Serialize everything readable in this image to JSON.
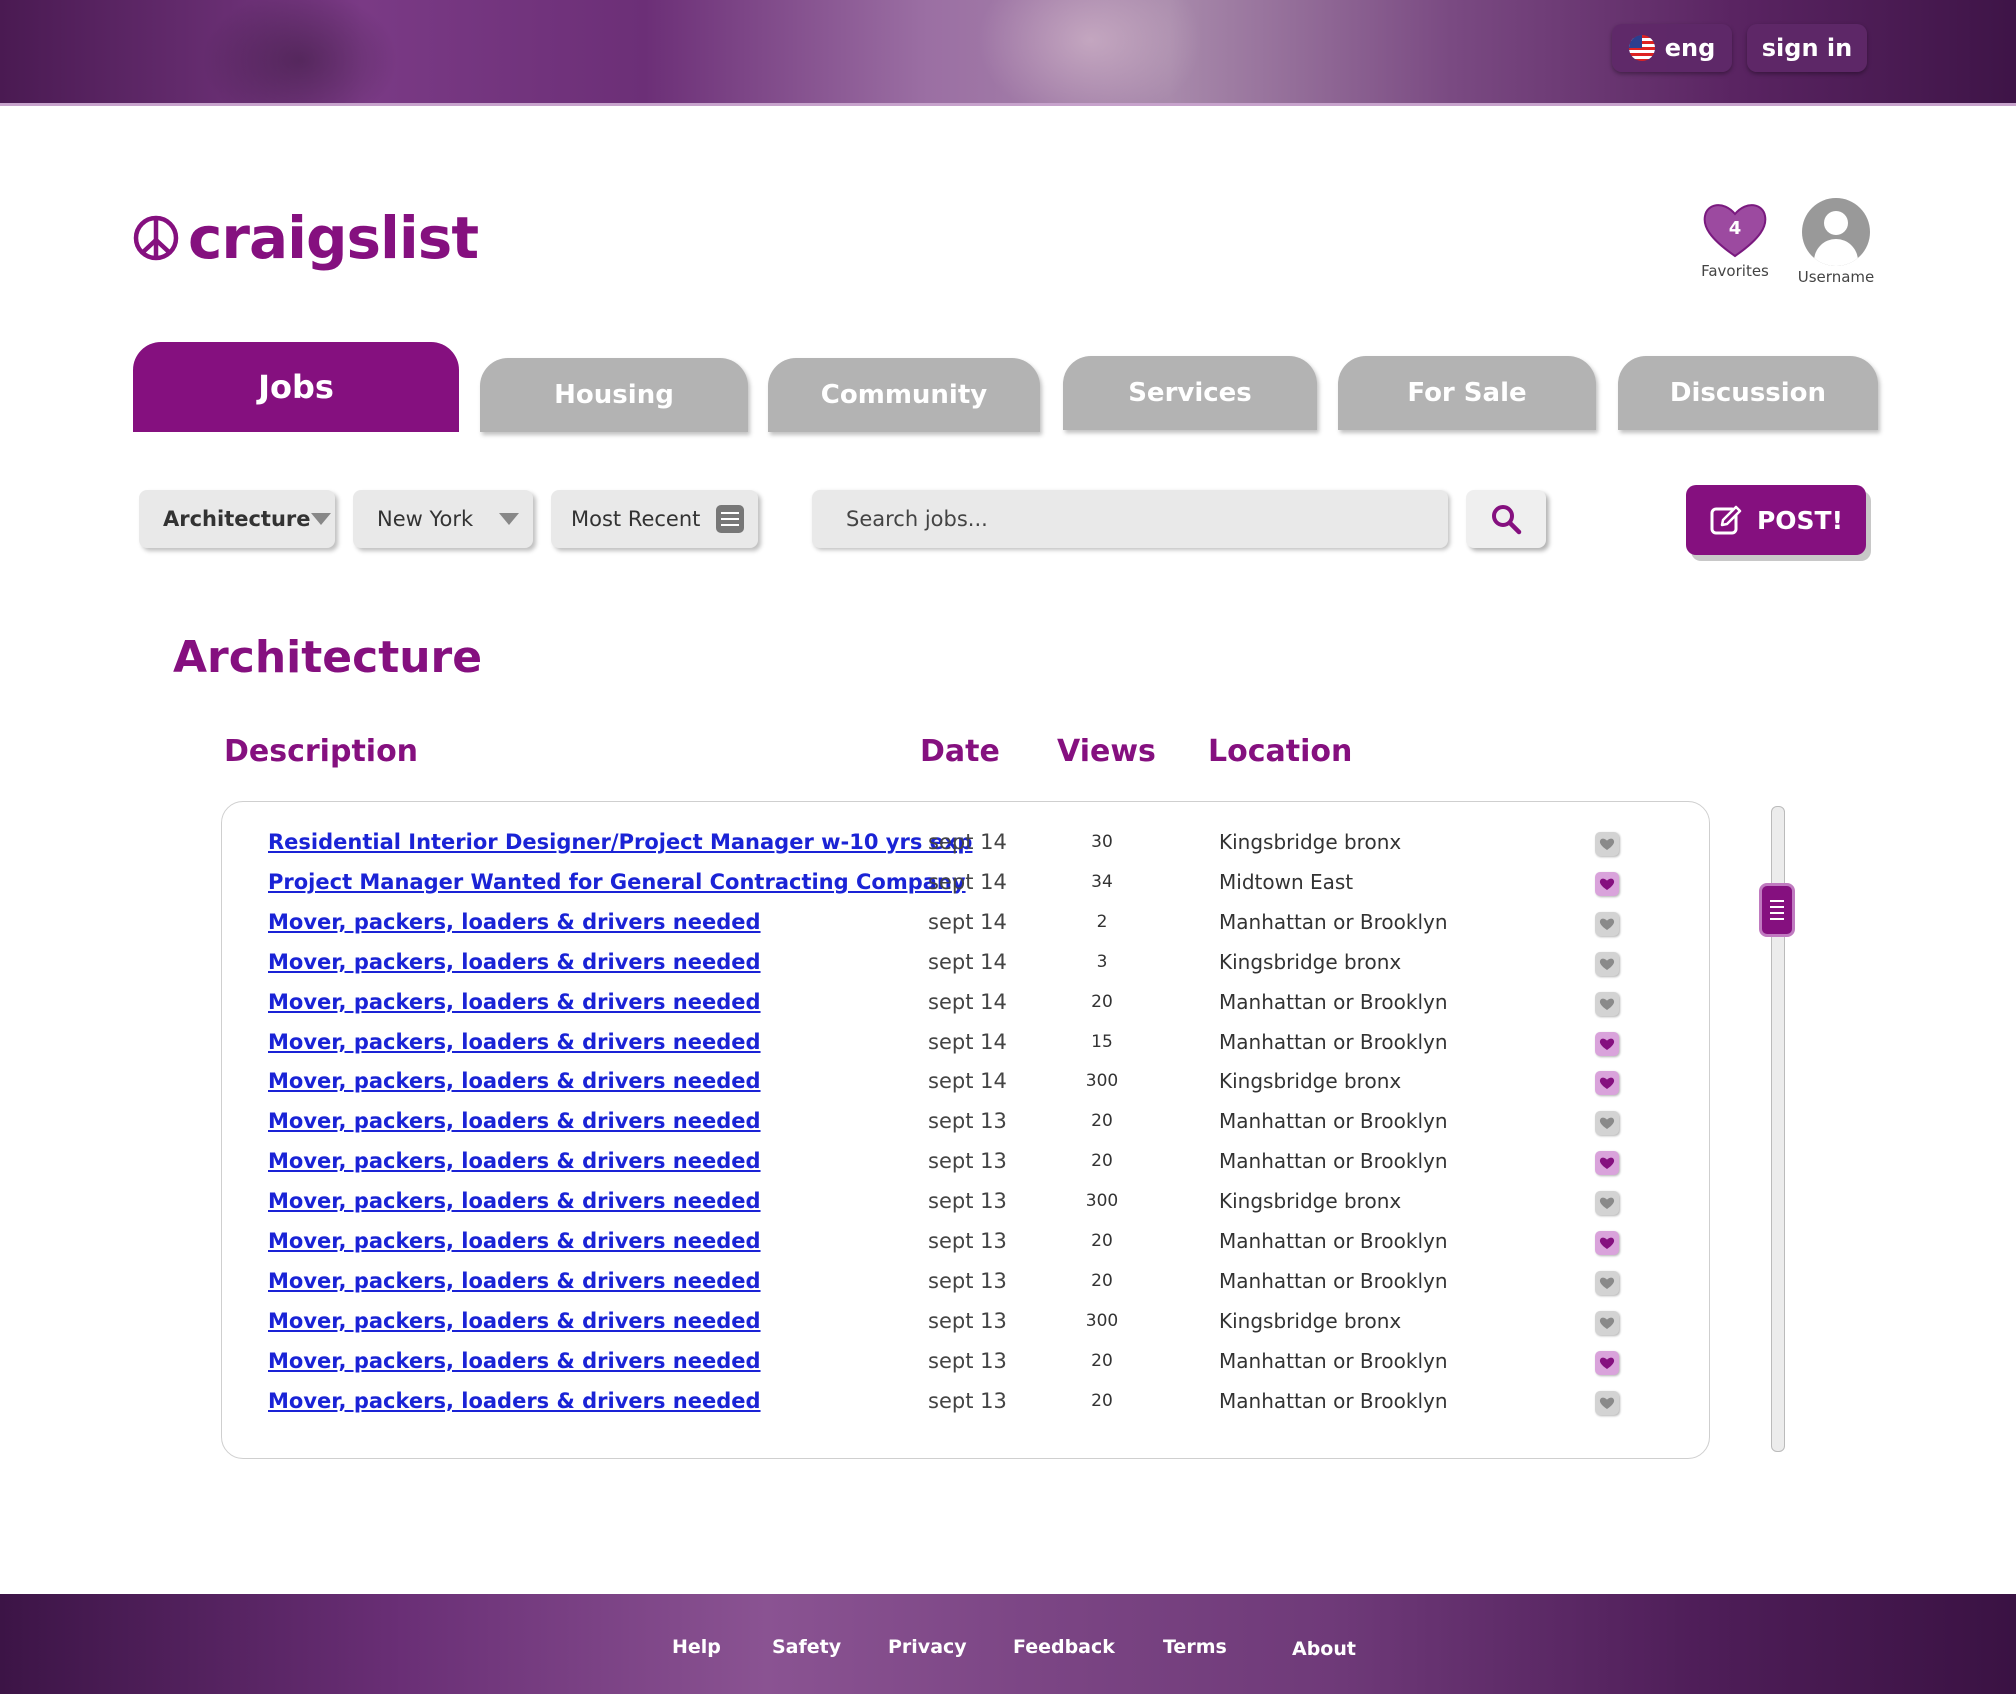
{
  "header": {
    "language": "eng",
    "sign_in": "sign in"
  },
  "brand": {
    "name": "craigslist"
  },
  "user_area": {
    "favorites_count": "4",
    "favorites_label": "Favorites",
    "username_label": "Username"
  },
  "tabs": [
    {
      "label": "Jobs",
      "active": true
    },
    {
      "label": "Housing"
    },
    {
      "label": "Community"
    },
    {
      "label": "Services"
    },
    {
      "label": "For Sale"
    },
    {
      "label": "Discussion"
    }
  ],
  "filters": {
    "category": "Architecture",
    "city": "New York",
    "sort": "Most Recent"
  },
  "search": {
    "placeholder": "Search jobs..."
  },
  "post_button": "POST!",
  "section_title": "Architecture",
  "columns": {
    "description": "Description",
    "date": "Date",
    "views": "Views",
    "location": "Location"
  },
  "listings": [
    {
      "description": "Residential Interior Designer/Project Manager w-10 yrs exp",
      "date": "sept 14",
      "views": "30",
      "location": "Kingsbridge bronx",
      "favorite": false
    },
    {
      "description": "Project Manager Wanted for General Contracting Company",
      "date": "sept 14",
      "views": "34",
      "location": "Midtown East",
      "favorite": true
    },
    {
      "description": "Mover, packers, loaders & drivers needed",
      "date": "sept 14",
      "views": "2",
      "location": "Manhattan or Brooklyn",
      "favorite": false
    },
    {
      "description": "Mover, packers, loaders & drivers needed",
      "date": "sept 14",
      "views": "3",
      "location": "Kingsbridge bronx",
      "favorite": false
    },
    {
      "description": "Mover, packers, loaders & drivers needed",
      "date": "sept 14",
      "views": "20",
      "location": "Manhattan or Brooklyn",
      "favorite": false
    },
    {
      "description": "Mover, packers, loaders & drivers needed",
      "date": "sept 14",
      "views": "15",
      "location": "Manhattan or Brooklyn",
      "favorite": true
    },
    {
      "description": "Mover, packers, loaders & drivers needed",
      "date": "sept 14",
      "views": "300",
      "location": "Kingsbridge bronx",
      "favorite": true
    },
    {
      "description": "Mover, packers, loaders & drivers needed",
      "date": "sept 13",
      "views": "20",
      "location": "Manhattan or Brooklyn",
      "favorite": false
    },
    {
      "description": "Mover, packers, loaders & drivers needed",
      "date": "sept 13",
      "views": "20",
      "location": "Manhattan or Brooklyn",
      "favorite": true
    },
    {
      "description": "Mover, packers, loaders & drivers needed",
      "date": "sept 13",
      "views": "300",
      "location": "Kingsbridge bronx",
      "favorite": false
    },
    {
      "description": "Mover, packers, loaders & drivers needed",
      "date": "sept 13",
      "views": "20",
      "location": "Manhattan or Brooklyn",
      "favorite": true
    },
    {
      "description": "Mover, packers, loaders & drivers needed",
      "date": "sept 13",
      "views": "20",
      "location": "Manhattan or Brooklyn",
      "favorite": false
    },
    {
      "description": "Mover, packers, loaders & drivers needed",
      "date": "sept 13",
      "views": "300",
      "location": "Kingsbridge bronx",
      "favorite": false
    },
    {
      "description": "Mover, packers, loaders & drivers needed",
      "date": "sept 13",
      "views": "20",
      "location": "Manhattan or Brooklyn",
      "favorite": true
    },
    {
      "description": "Mover, packers, loaders & drivers needed",
      "date": "sept 13",
      "views": "20",
      "location": "Manhattan or Brooklyn",
      "favorite": false
    }
  ],
  "footer": {
    "links": [
      "Help",
      "Safety",
      "Privacy",
      "Feedback",
      "Terms",
      "About"
    ]
  },
  "colors": {
    "brand_purple": "#85107f",
    "link_blue": "#1a23d6",
    "tab_gray": "#b3b3b3",
    "favorite_on": "#d9a3db",
    "favorite_off": "#d3d3d3"
  },
  "icons": {
    "language": "us-flag-icon",
    "favorites": "heart-icon",
    "user": "user-avatar-icon",
    "sort": "sliders-icon",
    "search": "search-icon",
    "post": "edit-icon",
    "logo": "peace-icon"
  }
}
